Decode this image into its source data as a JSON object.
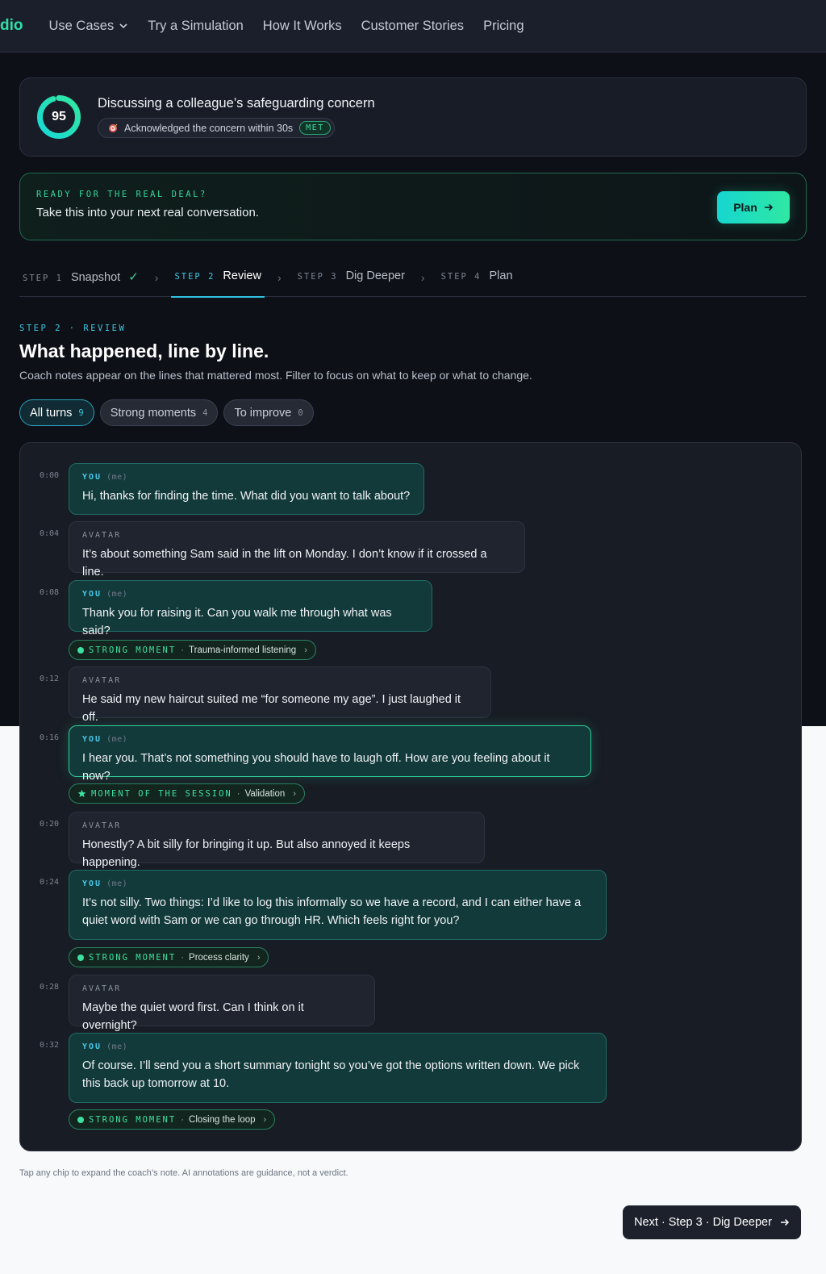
{
  "nav": {
    "brand": "dio",
    "items": [
      {
        "label": "Use Cases",
        "has_dropdown": true
      },
      {
        "label": "Try a Simulation"
      },
      {
        "label": "How It Works"
      },
      {
        "label": "Customer Stories"
      },
      {
        "label": "Pricing"
      }
    ]
  },
  "score": {
    "value": "95",
    "value_fraction": 0.95,
    "title": "Discussing a colleague’s safeguarding concern",
    "criterion": "Acknowledged the concern within 30s",
    "criterion_status": "MET"
  },
  "ready": {
    "kicker": "READY FOR THE REAL DEAL?",
    "text": "Take this into your next real conversation.",
    "button": "Plan"
  },
  "steps": [
    {
      "label": "STEP 1",
      "name": "Snapshot",
      "done": true
    },
    {
      "label": "STEP 2",
      "name": "Review",
      "active": true
    },
    {
      "label": "STEP 3",
      "name": "Dig Deeper"
    },
    {
      "label": "STEP 4",
      "name": "Plan"
    }
  ],
  "section": {
    "kicker": "STEP 2 · REVIEW",
    "title": "What happened, line by line.",
    "description": "Coach notes appear on the lines that mattered most. Filter to focus on what to keep or what to change."
  },
  "filters": [
    {
      "label": "All turns",
      "count": "9",
      "active": true
    },
    {
      "label": "Strong moments",
      "count": "4"
    },
    {
      "label": "To improve",
      "count": "0"
    }
  ],
  "speaker_labels": {
    "you": "YOU",
    "me": "(me)",
    "avatar": "AVATAR"
  },
  "turns": [
    {
      "time": "0:00",
      "speaker": "you",
      "text": "Hi, thanks for finding the time. What did you want to talk about?"
    },
    {
      "time": "0:04",
      "speaker": "avatar",
      "text": "It’s about something Sam said in the lift on Monday. I don’t know if it crossed a line."
    },
    {
      "time": "0:08",
      "speaker": "you",
      "text": "Thank you for raising it. Can you walk me through what was said?",
      "chip": {
        "kind": "STRONG MOMENT",
        "note": "Trauma-informed listening"
      }
    },
    {
      "time": "0:12",
      "speaker": "avatar",
      "text": "He said my new haircut suited me “for someone my age”. I just laughed it off."
    },
    {
      "time": "0:16",
      "speaker": "you",
      "text": "I hear you. That’s not something you should have to laugh off. How are you feeling about it now?",
      "chip": {
        "kind": "MOMENT OF THE SESSION",
        "note": "Validation"
      }
    },
    {
      "time": "0:20",
      "speaker": "avatar",
      "text": "Honestly? A bit silly for bringing it up. But also annoyed it keeps happening."
    },
    {
      "time": "0:24",
      "speaker": "you",
      "text": "It’s not silly. Two things: I’d like to log this informally so we have a record, and I can either have a quiet word with Sam or we can go through HR. Which feels right for you?",
      "chip": {
        "kind": "STRONG MOMENT",
        "note": "Process clarity"
      }
    },
    {
      "time": "0:28",
      "speaker": "avatar",
      "text": "Maybe the quiet word first. Can I think on it overnight?"
    },
    {
      "time": "0:32",
      "speaker": "you",
      "text": "Of course. I’ll send you a short summary tonight so you’ve got the options written down. We pick this back up tomorrow at 10.",
      "chip": {
        "kind": "STRONG MOMENT",
        "note": "Closing the loop"
      }
    }
  ],
  "footnote": "Tap any chip to expand the coach’s note. AI annotations are guidance, not a verdict.",
  "next_button": "Next · Step 3 · Dig Deeper",
  "colors": {
    "accent": "#2fe0a8",
    "cyan": "#3ec6e0",
    "card": "#181c24"
  }
}
